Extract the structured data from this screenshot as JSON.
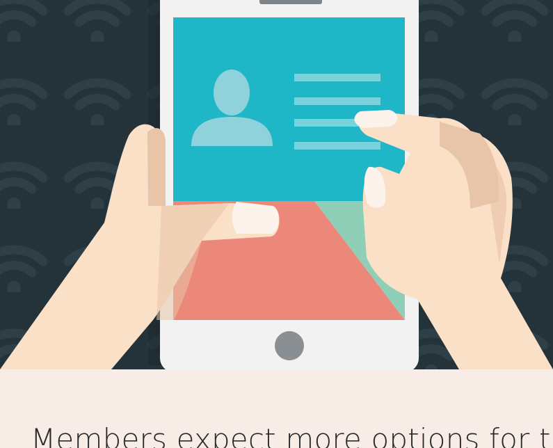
{
  "hero": {
    "illustration": "hands-holding-phone-with-profile-card",
    "icon": "wifi-pattern-icon",
    "colors": {
      "background": "#243239",
      "wifi_pattern": "#2f3f47",
      "phone_body": "#f2f2f3",
      "screen_top": "#1fb7c8",
      "screen_coral": "#ec887a",
      "screen_mint": "#8fcfb8",
      "avatar": "#8fd2dc",
      "text_lines": "#7ad2dc",
      "skin": "#fbe0c8",
      "skin_shadow": "#e8c4a8",
      "nail": "#fbf3ec"
    }
  },
  "caption": {
    "text": "Members expect more options for t"
  }
}
